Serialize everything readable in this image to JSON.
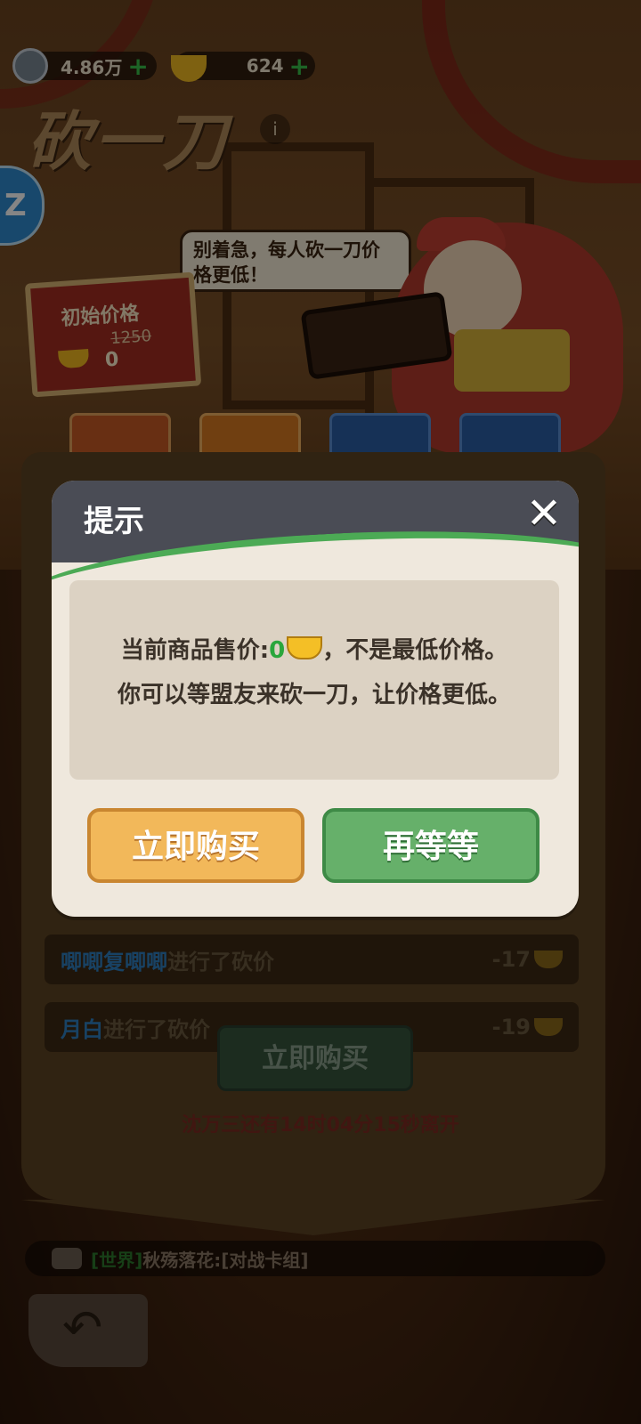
{
  "topbar": {
    "coins": {
      "value": "4.86万",
      "icon": "copper-coin-icon",
      "add": "+"
    },
    "ingots": {
      "value": "624",
      "icon": "gold-ingot-icon",
      "add": "+"
    }
  },
  "page_title": "砍一刀",
  "info_icon": "i",
  "side_button": "Z",
  "speech": "别着急，每人砍一刀价格更低！",
  "sign": {
    "label": "初始价格",
    "original": "1250",
    "current": "0"
  },
  "bargain_log": [
    {
      "name": "唧唧复唧唧",
      "action": "进行了砍价",
      "delta": "-17"
    },
    {
      "name": "月白",
      "action": "进行了砍价",
      "delta": "-19"
    }
  ],
  "buy_now_bg": "立即购买",
  "leave_notice": "沈万三还有14时04分15秒离开",
  "chat": {
    "channel": "[世界]",
    "message": "秋殇落花:[对战卡组]"
  },
  "back_icon": "↶",
  "dialog": {
    "title": "提示",
    "close": "✕",
    "line1_prefix": "当前商品售价:",
    "line1_price": "0",
    "line1_suffix": "，不是最低价格。",
    "line2": "你可以等盟友来砍一刀，让价格更低。",
    "buy_label": "立即购买",
    "wait_label": "再等等"
  },
  "colors": {
    "accent_green": "#4caa55",
    "buy_orange": "#f2b85a",
    "wait_green": "#66b06a",
    "name_blue": "#2f7fc0"
  }
}
